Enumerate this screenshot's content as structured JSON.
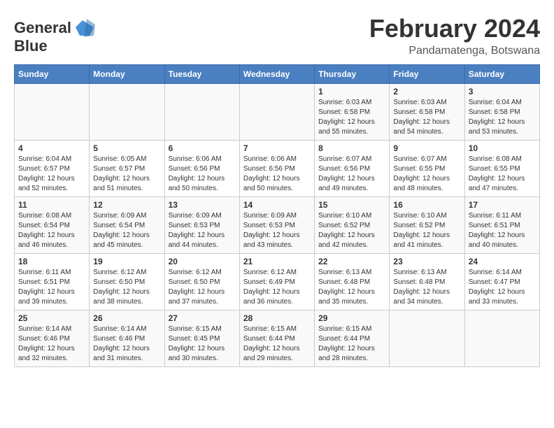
{
  "logo": {
    "text_general": "General",
    "text_blue": "Blue"
  },
  "title": "February 2024",
  "location": "Pandamatenga, Botswana",
  "weekdays": [
    "Sunday",
    "Monday",
    "Tuesday",
    "Wednesday",
    "Thursday",
    "Friday",
    "Saturday"
  ],
  "weeks": [
    [
      {
        "day": "",
        "info": ""
      },
      {
        "day": "",
        "info": ""
      },
      {
        "day": "",
        "info": ""
      },
      {
        "day": "",
        "info": ""
      },
      {
        "day": "1",
        "info": "Sunrise: 6:03 AM\nSunset: 6:58 PM\nDaylight: 12 hours\nand 55 minutes."
      },
      {
        "day": "2",
        "info": "Sunrise: 6:03 AM\nSunset: 6:58 PM\nDaylight: 12 hours\nand 54 minutes."
      },
      {
        "day": "3",
        "info": "Sunrise: 6:04 AM\nSunset: 6:58 PM\nDaylight: 12 hours\nand 53 minutes."
      }
    ],
    [
      {
        "day": "4",
        "info": "Sunrise: 6:04 AM\nSunset: 6:57 PM\nDaylight: 12 hours\nand 52 minutes."
      },
      {
        "day": "5",
        "info": "Sunrise: 6:05 AM\nSunset: 6:57 PM\nDaylight: 12 hours\nand 51 minutes."
      },
      {
        "day": "6",
        "info": "Sunrise: 6:06 AM\nSunset: 6:56 PM\nDaylight: 12 hours\nand 50 minutes."
      },
      {
        "day": "7",
        "info": "Sunrise: 6:06 AM\nSunset: 6:56 PM\nDaylight: 12 hours\nand 50 minutes."
      },
      {
        "day": "8",
        "info": "Sunrise: 6:07 AM\nSunset: 6:56 PM\nDaylight: 12 hours\nand 49 minutes."
      },
      {
        "day": "9",
        "info": "Sunrise: 6:07 AM\nSunset: 6:55 PM\nDaylight: 12 hours\nand 48 minutes."
      },
      {
        "day": "10",
        "info": "Sunrise: 6:08 AM\nSunset: 6:55 PM\nDaylight: 12 hours\nand 47 minutes."
      }
    ],
    [
      {
        "day": "11",
        "info": "Sunrise: 6:08 AM\nSunset: 6:54 PM\nDaylight: 12 hours\nand 46 minutes."
      },
      {
        "day": "12",
        "info": "Sunrise: 6:09 AM\nSunset: 6:54 PM\nDaylight: 12 hours\nand 45 minutes."
      },
      {
        "day": "13",
        "info": "Sunrise: 6:09 AM\nSunset: 6:53 PM\nDaylight: 12 hours\nand 44 minutes."
      },
      {
        "day": "14",
        "info": "Sunrise: 6:09 AM\nSunset: 6:53 PM\nDaylight: 12 hours\nand 43 minutes."
      },
      {
        "day": "15",
        "info": "Sunrise: 6:10 AM\nSunset: 6:52 PM\nDaylight: 12 hours\nand 42 minutes."
      },
      {
        "day": "16",
        "info": "Sunrise: 6:10 AM\nSunset: 6:52 PM\nDaylight: 12 hours\nand 41 minutes."
      },
      {
        "day": "17",
        "info": "Sunrise: 6:11 AM\nSunset: 6:51 PM\nDaylight: 12 hours\nand 40 minutes."
      }
    ],
    [
      {
        "day": "18",
        "info": "Sunrise: 6:11 AM\nSunset: 6:51 PM\nDaylight: 12 hours\nand 39 minutes."
      },
      {
        "day": "19",
        "info": "Sunrise: 6:12 AM\nSunset: 6:50 PM\nDaylight: 12 hours\nand 38 minutes."
      },
      {
        "day": "20",
        "info": "Sunrise: 6:12 AM\nSunset: 6:50 PM\nDaylight: 12 hours\nand 37 minutes."
      },
      {
        "day": "21",
        "info": "Sunrise: 6:12 AM\nSunset: 6:49 PM\nDaylight: 12 hours\nand 36 minutes."
      },
      {
        "day": "22",
        "info": "Sunrise: 6:13 AM\nSunset: 6:48 PM\nDaylight: 12 hours\nand 35 minutes."
      },
      {
        "day": "23",
        "info": "Sunrise: 6:13 AM\nSunset: 6:48 PM\nDaylight: 12 hours\nand 34 minutes."
      },
      {
        "day": "24",
        "info": "Sunrise: 6:14 AM\nSunset: 6:47 PM\nDaylight: 12 hours\nand 33 minutes."
      }
    ],
    [
      {
        "day": "25",
        "info": "Sunrise: 6:14 AM\nSunset: 6:46 PM\nDaylight: 12 hours\nand 32 minutes."
      },
      {
        "day": "26",
        "info": "Sunrise: 6:14 AM\nSunset: 6:46 PM\nDaylight: 12 hours\nand 31 minutes."
      },
      {
        "day": "27",
        "info": "Sunrise: 6:15 AM\nSunset: 6:45 PM\nDaylight: 12 hours\nand 30 minutes."
      },
      {
        "day": "28",
        "info": "Sunrise: 6:15 AM\nSunset: 6:44 PM\nDaylight: 12 hours\nand 29 minutes."
      },
      {
        "day": "29",
        "info": "Sunrise: 6:15 AM\nSunset: 6:44 PM\nDaylight: 12 hours\nand 28 minutes."
      },
      {
        "day": "",
        "info": ""
      },
      {
        "day": "",
        "info": ""
      }
    ]
  ]
}
